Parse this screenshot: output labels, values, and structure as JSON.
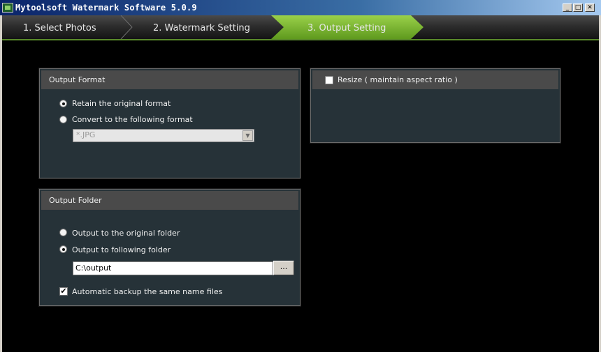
{
  "window": {
    "title": "Mytoolsoft Watermark Software 5.0.9",
    "minimize_glyph": "_",
    "maximize_glyph": "□",
    "close_glyph": "✕"
  },
  "tabs": [
    {
      "label": "1. Select Photos",
      "active": false
    },
    {
      "label": "2. Watermark Setting",
      "active": false
    },
    {
      "label": "3. Output Setting",
      "active": true
    }
  ],
  "colors": {
    "active_tab": "#7cb632",
    "panel_bg": "#263238",
    "panel_header": "#4a4a4a"
  },
  "output_format": {
    "title": "Output Format",
    "retain_label": "Retain the original format",
    "retain_selected": true,
    "convert_label": "Convert to the following format",
    "convert_selected": false,
    "format_value": "*.JPG"
  },
  "resize": {
    "label": "Resize ( maintain aspect ratio )",
    "checked": false
  },
  "output_folder": {
    "title": "Output Folder",
    "original_label": "Output to the original folder",
    "original_selected": false,
    "following_label": "Output to following folder",
    "following_selected": true,
    "path_value": "C:\\output",
    "browse_label": "...",
    "backup_label": "Automatic backup the same name files",
    "backup_checked": true,
    "backup_glyph": "✔"
  }
}
